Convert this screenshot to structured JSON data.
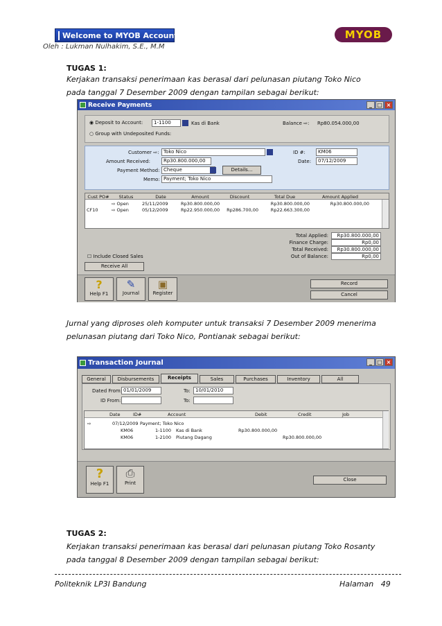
{
  "header": {
    "banner": "Welcome to MYOB Accounting",
    "logo": "MYOB",
    "author": "Oleh : Lukman Nulhakim, S.E., M.M"
  },
  "tugas1": {
    "title": "TUGAS 1:",
    "line1": "Kerjakan  transaksi penerimaan kas berasal dari pelunasan piutang Toko Nico",
    "line2": "pada tanggal 7 Desember 2009 dengan tampilan sebagai berikut:"
  },
  "receive": {
    "title": "Receive Payments",
    "deposit_label": "Deposit to Account:",
    "deposit_account": "1-1100",
    "deposit_name": "Kas di Bank",
    "group_label": "Group with Undeposited Funds:",
    "balance_label": "Balance ⇨:",
    "balance_value": "Rp80.054.000,00",
    "customer_label": "Customer ⇨:",
    "customer": "Toko Nico",
    "id_label": "ID #:",
    "id": "KM06",
    "amount_label": "Amount Received:",
    "amount": "Rp30.800.000,00",
    "date_label": "Date:",
    "date": "07/12/2009",
    "method_label": "Payment Method:",
    "method": "Cheque",
    "details_btn": "Details...",
    "memo_label": "Memo:",
    "memo": "Payment; Toko Nico",
    "columns": [
      "Cust PO#",
      "Status",
      "Date",
      "Amount",
      "Discount",
      "Total Due",
      "Amount Applied"
    ],
    "rows": [
      [
        "",
        "⇨ Open",
        "25/11/2009",
        "Rp30.800.000,00",
        "",
        "Rp30.800.000,00",
        "Rp30.800.000,00"
      ],
      [
        "CF10",
        "⇨ Open",
        "05/12/2009",
        "Rp22.950.000,00",
        "Rp286.700,00",
        "Rp22.663.300,00",
        ""
      ]
    ],
    "include_closed": "Include Closed Sales",
    "receive_all": "Receive All",
    "totals": [
      {
        "label": "Total Applied:",
        "value": "Rp30.800.000,00"
      },
      {
        "label": "Finance Charge:",
        "value": "Rp0,00"
      },
      {
        "label": "Total Received:",
        "value": "Rp30.800.000,00"
      },
      {
        "label": "Out of Balance:",
        "value": "Rp0,00"
      }
    ],
    "help": "Help F1",
    "journal": "Journal",
    "register": "Register",
    "record": "Record",
    "cancel": "Cancel"
  },
  "para2": {
    "line1": "Jurnal yang diproses oleh komputer untuk transaksi 7 Desember 2009 menerima",
    "line2": "pelunasan piutang dari Toko Nico, Pontianak sebagai berikut:"
  },
  "journal": {
    "title": "Transaction Journal",
    "tabs": [
      "General",
      "Disbursements",
      "Receipts",
      "Sales",
      "Purchases",
      "Inventory",
      "All"
    ],
    "active_tab": "Receipts",
    "dated_from_label": "Dated From:",
    "dated_from": "01/01/2009",
    "to_label": "To:",
    "to": "10/01/2010",
    "id_from_label": "ID From:",
    "id_to_label": "To:",
    "columns": [
      "Date",
      "ID#",
      "Account",
      "Debit",
      "Credit",
      "Job"
    ],
    "entry_date": "07/12/2009",
    "entry_memo": "Payment; Toko Nico",
    "lines": [
      {
        "id": "KM06",
        "acct": "1-1100",
        "name": "Kas di Bank",
        "debit": "Rp30.800.000,00",
        "credit": ""
      },
      {
        "id": "KM06",
        "acct": "1-2100",
        "name": "Piutang Dagang",
        "debit": "",
        "credit": "Rp30.800.000,00"
      }
    ],
    "help": "Help F1",
    "print": "Print",
    "close": "Close"
  },
  "tugas2": {
    "title": "TUGAS 2:",
    "line1": "Kerjakan transaksi penerimaan kas berasal dari pelunasan piutang Toko Rosanty",
    "line2": "pada tanggal 8 Desember 2009 dengan tampilan sebagai berikut:"
  },
  "footer": {
    "left": "Politeknik LP3I Bandung",
    "page_label": "Halaman",
    "page_number": "49"
  }
}
